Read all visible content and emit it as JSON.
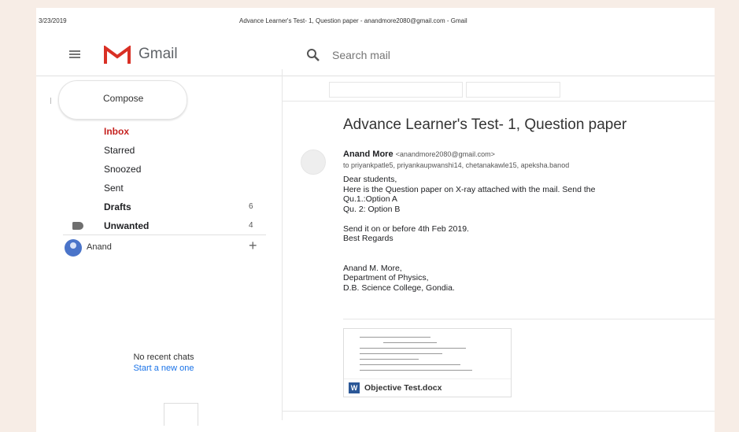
{
  "print_header": {
    "date": "3/23/2019",
    "title": "Advance Learner's Test- 1, Question paper - anandmore2080@gmail.com - Gmail"
  },
  "header": {
    "brand": "Gmail",
    "search_placeholder": "Search mail"
  },
  "sidebar": {
    "compose_label": "Compose",
    "items": [
      {
        "label": "Inbox",
        "count": ""
      },
      {
        "label": "Starred",
        "count": ""
      },
      {
        "label": "Snoozed",
        "count": ""
      },
      {
        "label": "Sent",
        "count": ""
      },
      {
        "label": "Drafts",
        "count": "6"
      },
      {
        "label": "Unwanted",
        "count": "4"
      }
    ],
    "hangouts_user": "Anand",
    "no_chats": "No recent chats",
    "start_new": "Start a new one"
  },
  "email": {
    "subject": "Advance Learner's Test- 1, Question paper",
    "sender_name": "Anand More",
    "sender_email": "<anandmore2080@gmail.com>",
    "to": "to priyankpatle5, priyankaupwanshi14, chetanakawle15, apeksha.banod",
    "body": [
      "Dear students,",
      "Here is the Question paper on X-ray attached with the mail. Send the",
      "Qu.1.:Option A",
      "Qu. 2: Option B",
      "",
      "Send it on or before 4th Feb 2019.",
      "Best Regards",
      "",
      "",
      "Anand M. More,",
      "Department of Physics,",
      "D.B. Science College, Gondia."
    ],
    "attachment": {
      "icon_letter": "W",
      "name": "Objective Test.docx"
    }
  },
  "colors": {
    "accent_inbox": "#c5221f",
    "link": "#1a73e8",
    "word": "#2b5797"
  }
}
